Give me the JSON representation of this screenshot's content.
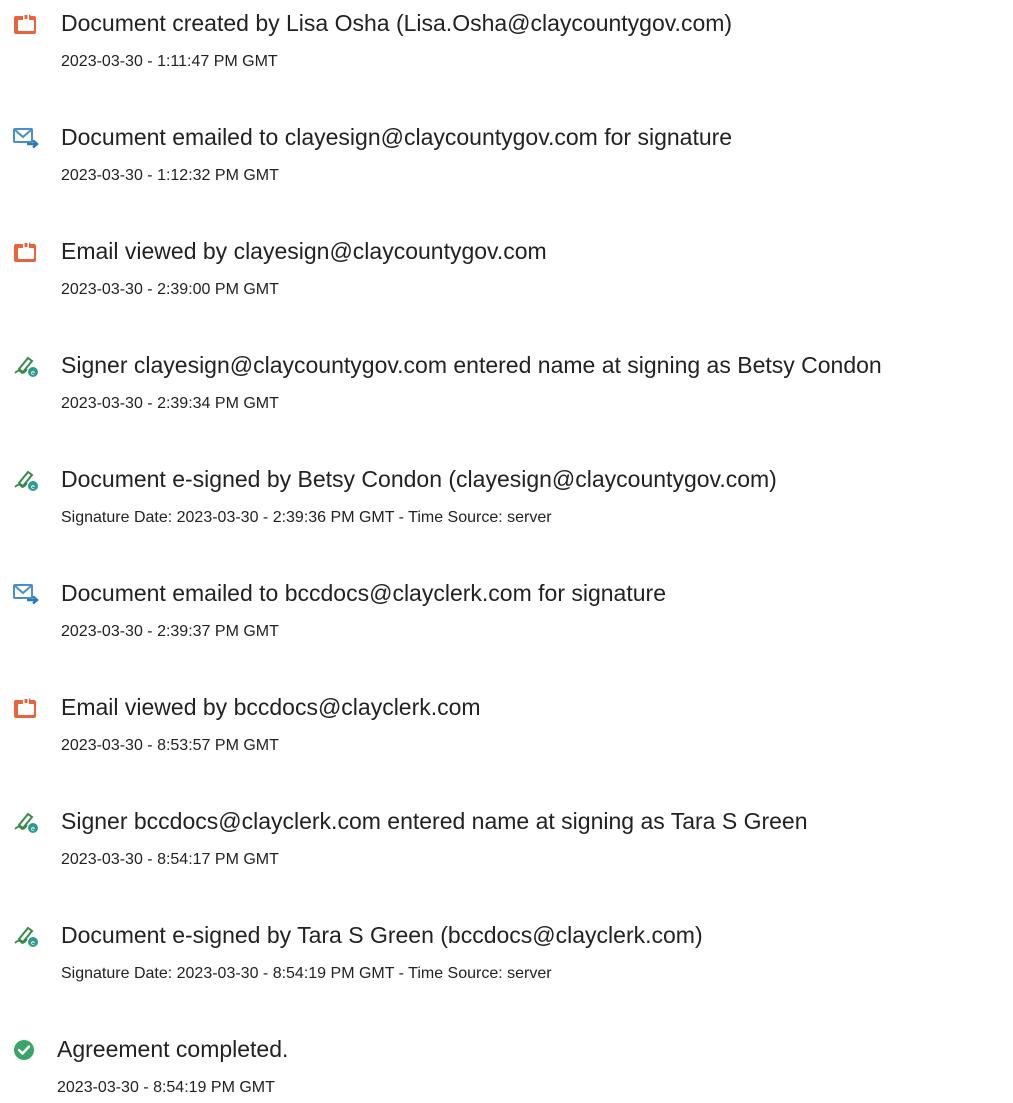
{
  "events": [
    {
      "icon": "document-created-icon",
      "title": "Document created by Lisa Osha (Lisa.Osha@claycountygov.com)",
      "detail": "2023-03-30 - 1:11:47 PM GMT"
    },
    {
      "icon": "email-sent-icon",
      "title": "Document emailed to clayesign@claycountygov.com for signature",
      "detail": "2023-03-30 - 1:12:32 PM GMT"
    },
    {
      "icon": "email-viewed-icon",
      "title": "Email viewed by clayesign@claycountygov.com",
      "detail": "2023-03-30 - 2:39:00 PM GMT"
    },
    {
      "icon": "signer-pen-icon",
      "title": "Signer clayesign@claycountygov.com entered name at signing as Betsy Condon",
      "detail": "2023-03-30 - 2:39:34 PM GMT"
    },
    {
      "icon": "e-signed-pen-icon",
      "title": "Document e-signed by Betsy Condon (clayesign@claycountygov.com)",
      "detail": "Signature Date: 2023-03-30 - 2:39:36 PM GMT - Time Source: server"
    },
    {
      "icon": "email-sent-icon",
      "title": "Document emailed to bccdocs@clayclerk.com for signature",
      "detail": "2023-03-30 - 2:39:37 PM GMT"
    },
    {
      "icon": "email-viewed-icon",
      "title": "Email viewed by bccdocs@clayclerk.com",
      "detail": "2023-03-30 - 8:53:57 PM GMT"
    },
    {
      "icon": "signer-pen-icon",
      "title": "Signer bccdocs@clayclerk.com entered name at signing as Tara S Green",
      "detail": "2023-03-30 - 8:54:17 PM GMT"
    },
    {
      "icon": "e-signed-pen-icon",
      "title": "Document e-signed by Tara S Green (bccdocs@clayclerk.com)",
      "detail": "Signature Date: 2023-03-30 - 8:54:19 PM GMT - Time Source: server"
    },
    {
      "icon": "check-circle-icon",
      "title": "Agreement completed.",
      "detail": "2023-03-30 - 8:54:19 PM GMT"
    }
  ],
  "colors": {
    "doc_orange": "#e8643c",
    "email_blue": "#4a90c8",
    "pen_green": "#3a8a4a",
    "pen_teal": "#2f9a8c",
    "check_green": "#3aa56a"
  }
}
